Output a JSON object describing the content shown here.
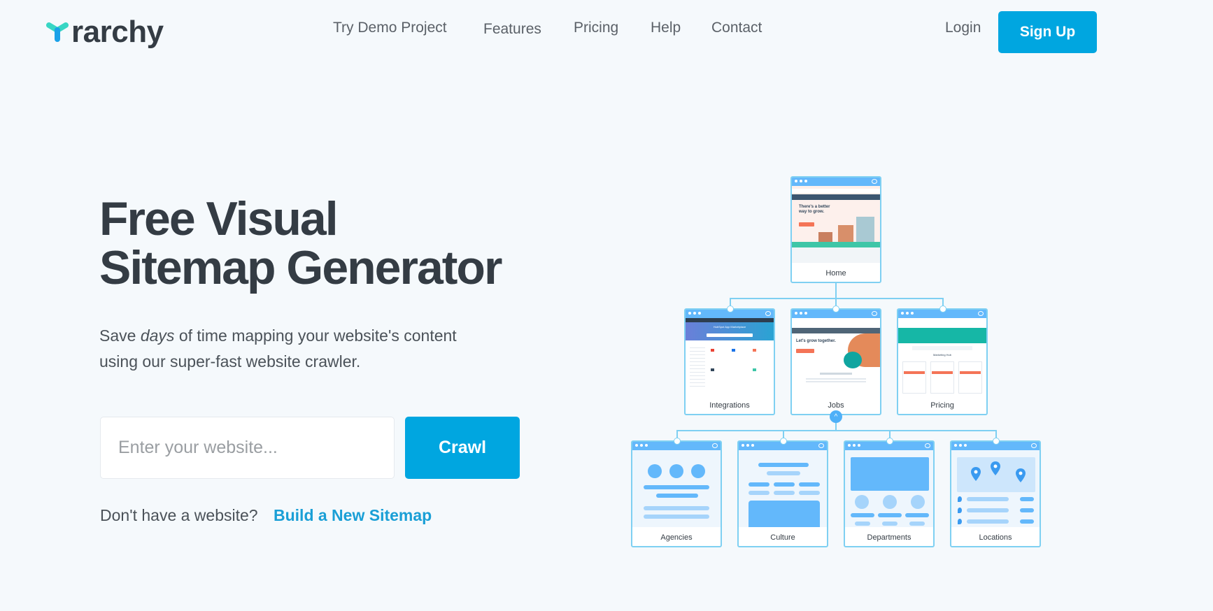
{
  "brand": {
    "name": "rarchy",
    "logo_colors": [
      "#38d6c4",
      "#1aa1e8"
    ]
  },
  "nav": {
    "items": [
      {
        "label": "Try Demo Project"
      },
      {
        "label": "Features"
      },
      {
        "label": "Pricing"
      },
      {
        "label": "Help"
      },
      {
        "label": "Contact"
      }
    ],
    "login_label": "Login",
    "signup_label": "Sign Up"
  },
  "hero": {
    "title_line1": "Free Visual",
    "title_line2": "Sitemap Generator",
    "subtitle_pre": "Save",
    "subtitle_em": "days",
    "subtitle_post": "of time mapping your website's content",
    "subtitle_line2": "using our super-fast website crawler.",
    "input_placeholder": "Enter your website...",
    "input_value": "",
    "crawl_label": "Crawl",
    "no_site_text": "Don't have a website?",
    "build_link": "Build a New Sitemap"
  },
  "sitemap": {
    "root": {
      "label": "Home",
      "preview_heading": "There's a better way to grow."
    },
    "level2": [
      {
        "label": "Integrations",
        "preview_heading": "HubSpot App Marketplace"
      },
      {
        "label": "Jobs",
        "preview_heading": "Let's grow together."
      },
      {
        "label": "Pricing",
        "preview_heading": "Marketing Hub"
      }
    ],
    "level3": [
      {
        "label": "Agencies"
      },
      {
        "label": "Culture"
      },
      {
        "label": "Departments"
      },
      {
        "label": "Locations"
      }
    ]
  },
  "colors": {
    "accent": "#00a6e0",
    "link": "#1a9fd6",
    "text": "#343c44",
    "background": "#f5f9fc",
    "diagram_line": "#7fd0f2",
    "wire_blue": "#63b8fb"
  }
}
